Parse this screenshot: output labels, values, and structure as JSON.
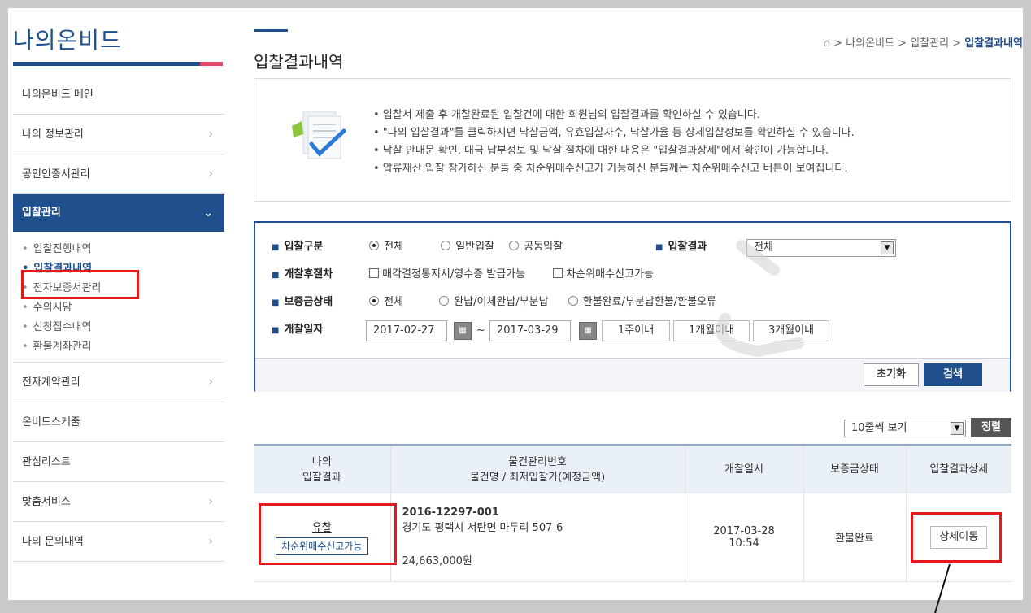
{
  "sidebar": {
    "brand": "나의온비드",
    "menu_top": [
      {
        "label": "나의온비드 메인",
        "chevron": ""
      },
      {
        "label": "나의 정보관리",
        "chevron": "›"
      },
      {
        "label": "공인인증서관리",
        "chevron": "›"
      }
    ],
    "active_menu": {
      "label": "입찰관리",
      "chevron": "⌄"
    },
    "submenu": [
      "입찰진행내역",
      "입찰결과내역",
      "전자보증서관리",
      "수의시담",
      "신청접수내역",
      "환불계좌관리"
    ],
    "menu_bottom": [
      {
        "label": "전자계약관리",
        "chevron": "›"
      },
      {
        "label": "온비드스케줄",
        "chevron": ""
      },
      {
        "label": "관심리스트",
        "chevron": ""
      },
      {
        "label": "맞춤서비스",
        "chevron": "›"
      },
      {
        "label": "나의 문의내역",
        "chevron": "›"
      }
    ]
  },
  "header": {
    "title": "입찰결과내역",
    "breadcrumb": [
      "나의온비드",
      "입찰관리",
      "입찰결과내역"
    ],
    "sep": ">"
  },
  "info": [
    "• 입찰서 제출 후 개찰완료된 입찰건에 대한 회원님의 입찰결과를 확인하실 수 있습니다.",
    "• \"나의 입찰결과\"를 클릭하시면 낙찰금액, 유효입찰자수, 낙찰가율 등 상세입찰정보를 확인하실 수 있습니다.",
    "• 낙찰 안내문 확인, 대금 납부정보 및 낙찰 절차에 대한 내용은 \"입찰결과상세\"에서 확인이 가능합니다.",
    "• 압류재산 입찰 참가하신 분들 중 차순위매수신고가 가능하신 분들께는 차순위매수신고 버튼이 보여집니다."
  ],
  "search": {
    "bid_type_label": "입찰구분",
    "bid_type_options": [
      "전체",
      "일반입찰",
      "공동입찰"
    ],
    "bid_result_label": "입찰결과",
    "bid_result_value": "전체",
    "after_label": "개찰후절차",
    "after_options": [
      "매각결정통지서/영수증 발급가능",
      "차순위매수신고가능"
    ],
    "deposit_label": "보증금상태",
    "deposit_options": [
      "전체",
      "완납/이체완납/부분납",
      "환불완료/부분납환불/환불오류"
    ],
    "date_label": "개찰일자",
    "date_from": "2017-02-27",
    "date_to": "2017-03-29",
    "tilde": "~",
    "period_buttons": [
      "1주이내",
      "1개월이내",
      "3개월이내"
    ],
    "reset_label": "초기화",
    "search_label": "검색"
  },
  "list": {
    "page_size": "10줄씩 보기",
    "sort_label": "정렬",
    "headers": {
      "col1_a": "나의",
      "col1_b": "입찰결과",
      "col2_a": "물건관리번호",
      "col2_b": "물건명 / 최저입찰가(예정금액)",
      "col3": "개찰일시",
      "col4": "보증금상태",
      "col5": "입찰결과상세"
    },
    "rows": [
      {
        "result": "유찰",
        "result_btn": "차순위매수신고가능",
        "item_no": "2016-12297-001",
        "item_name": "경기도 평택시 서탄면 마두리 507-6",
        "price": "24,663,000원",
        "date": "2017-03-28",
        "time": "10:54",
        "deposit": "환불완료",
        "detail_btn": "상세이동"
      }
    ]
  },
  "colors": {
    "primary": "#1f4f8c",
    "highlight": "#e5191b",
    "accent": "#e6456c"
  }
}
